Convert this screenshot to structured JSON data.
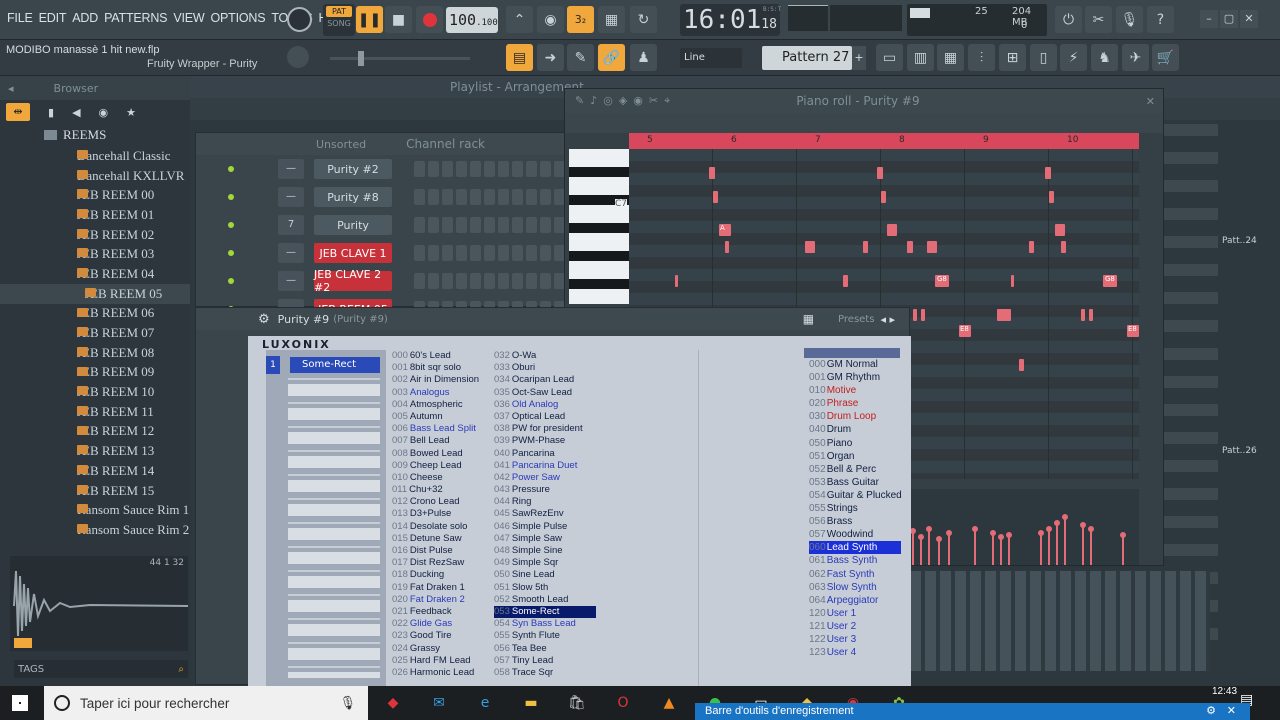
{
  "menu": [
    "FILE",
    "EDIT",
    "ADD",
    "PATTERNS",
    "VIEW",
    "OPTIONS",
    "TOOLS",
    "HELP"
  ],
  "transport": {
    "pat_label": "PAT",
    "song_label": "SONG",
    "tempo": "100",
    "tempo_fraction": ".100",
    "time_main": "16:01",
    "time_ticks": "18",
    "time_unit": "B:S:T"
  },
  "cpu": {
    "value": "25",
    "memory": "204 MB",
    "poly": "0"
  },
  "project": {
    "filename": "MODIBO manassè 1 hit new.flp",
    "hint": "Fruity Wrapper - Purity"
  },
  "toolbar": {
    "snap": "Line",
    "pattern": "Pattern 27"
  },
  "browser": {
    "title": "Browser",
    "root": "REEMS",
    "items": [
      "Dancehall Classic",
      "Dancehall KXLLVR",
      "JEB REEM 00",
      "JEB REEM 01",
      "JEB REEM 02",
      "JEB REEM 03",
      "JEB REEM 04",
      "JEB REEM 05",
      "JEB REEM 06",
      "JEB REEM 07",
      "JEB REEM 08",
      "JEB REEM 09",
      "JEB REEM 10",
      "JEB REEM 11",
      "JEB REEM 12",
      "JEB REEM 13",
      "JEB REEM 14",
      "JEB REEM 15",
      "Ransom Sauce Rim 1",
      "Ransom Sauce Rim 2"
    ],
    "selected_index": 7,
    "sample_info": "44 1 32",
    "tags_label": "TAGS"
  },
  "playlist": {
    "title": "Playlist - Arrangement",
    "pattern_labels": [
      "Patt..24",
      "Patt..26"
    ]
  },
  "channel_rack": {
    "title": "Channel rack",
    "filter": "Unsorted",
    "channels": [
      {
        "name": "Purity #2",
        "num": "—",
        "red": false
      },
      {
        "name": "Purity #8",
        "num": "—",
        "red": false
      },
      {
        "name": "Purity",
        "num": "7",
        "red": false
      },
      {
        "name": "JEB CLAVE 1",
        "num": "—",
        "red": true
      },
      {
        "name": "JEB CLAVE 2 #2",
        "num": "—",
        "red": true
      },
      {
        "name": "JEB REEM 05",
        "num": "",
        "red": true
      }
    ]
  },
  "piano_roll": {
    "title": "Piano roll - Purity #9",
    "ruler": [
      "5",
      "6",
      "7",
      "8",
      "9",
      "10"
    ],
    "key_label": "C7",
    "note_labels": [
      "A",
      "G8",
      "G8",
      "E8",
      "E8"
    ]
  },
  "purity": {
    "title": "Purity #9",
    "subtitle": "(Purity #9)",
    "presets_label": "Presets",
    "brand": "LUXONIX",
    "part1": "Some-Rect",
    "presets_a": [
      {
        "n": "000",
        "t": "60's Lead",
        "c": ""
      },
      {
        "n": "001",
        "t": "8bit sqr solo",
        "c": ""
      },
      {
        "n": "002",
        "t": "Air in Dimension",
        "c": ""
      },
      {
        "n": "003",
        "t": "Analogus",
        "c": "blue"
      },
      {
        "n": "004",
        "t": "Atmospheric",
        "c": ""
      },
      {
        "n": "005",
        "t": "Autumn",
        "c": ""
      },
      {
        "n": "006",
        "t": "Bass Lead Split",
        "c": "blue"
      },
      {
        "n": "007",
        "t": "Bell Lead",
        "c": ""
      },
      {
        "n": "008",
        "t": "Bowed Lead",
        "c": ""
      },
      {
        "n": "009",
        "t": "Cheep Lead",
        "c": ""
      },
      {
        "n": "010",
        "t": "Cheese",
        "c": ""
      },
      {
        "n": "011",
        "t": "Chu+32",
        "c": ""
      },
      {
        "n": "012",
        "t": "Crono Lead",
        "c": ""
      },
      {
        "n": "013",
        "t": "D3+Pulse",
        "c": ""
      },
      {
        "n": "014",
        "t": "Desolate solo",
        "c": ""
      },
      {
        "n": "015",
        "t": "Detune Saw",
        "c": ""
      },
      {
        "n": "016",
        "t": "Dist Pulse",
        "c": ""
      },
      {
        "n": "017",
        "t": "Dist RezSaw",
        "c": ""
      },
      {
        "n": "018",
        "t": "Ducking",
        "c": ""
      },
      {
        "n": "019",
        "t": "Fat Draken 1",
        "c": ""
      },
      {
        "n": "020",
        "t": "Fat Draken 2",
        "c": "blue"
      },
      {
        "n": "021",
        "t": "Feedback",
        "c": ""
      },
      {
        "n": "022",
        "t": "Glide Gas",
        "c": "blue"
      },
      {
        "n": "023",
        "t": "Good Tire",
        "c": ""
      },
      {
        "n": "024",
        "t": "Grassy",
        "c": ""
      },
      {
        "n": "025",
        "t": "Hard FM Lead",
        "c": ""
      },
      {
        "n": "026",
        "t": "Harmonic Lead",
        "c": ""
      }
    ],
    "presets_b": [
      {
        "n": "032",
        "t": "O-Wa",
        "c": ""
      },
      {
        "n": "033",
        "t": "Oburi",
        "c": ""
      },
      {
        "n": "034",
        "t": "Ocaripan Lead",
        "c": ""
      },
      {
        "n": "035",
        "t": "Oct-Saw Lead",
        "c": ""
      },
      {
        "n": "036",
        "t": "Old Analog",
        "c": "blue"
      },
      {
        "n": "037",
        "t": "Optical Lead",
        "c": ""
      },
      {
        "n": "038",
        "t": "PW for president",
        "c": ""
      },
      {
        "n": "039",
        "t": "PWM-Phase",
        "c": ""
      },
      {
        "n": "040",
        "t": "Pancarina",
        "c": ""
      },
      {
        "n": "041",
        "t": "Pancarina Duet",
        "c": "blue"
      },
      {
        "n": "042",
        "t": "Power Saw",
        "c": "blue"
      },
      {
        "n": "043",
        "t": "Pressure",
        "c": ""
      },
      {
        "n": "044",
        "t": "Ring",
        "c": ""
      },
      {
        "n": "045",
        "t": "SawRezEnv",
        "c": ""
      },
      {
        "n": "046",
        "t": "Simple Pulse",
        "c": ""
      },
      {
        "n": "047",
        "t": "Simple Saw",
        "c": ""
      },
      {
        "n": "048",
        "t": "Simple Sine",
        "c": ""
      },
      {
        "n": "049",
        "t": "Simple Sqr",
        "c": ""
      },
      {
        "n": "050",
        "t": "Sine Lead",
        "c": ""
      },
      {
        "n": "051",
        "t": "Slow 5th",
        "c": ""
      },
      {
        "n": "052",
        "t": "Smooth Lead",
        "c": ""
      },
      {
        "n": "053",
        "t": "Some-Rect",
        "c": "hl"
      },
      {
        "n": "054",
        "t": "Syn Bass Lead",
        "c": "blue"
      },
      {
        "n": "055",
        "t": "Synth Flute",
        "c": ""
      },
      {
        "n": "056",
        "t": "Tea Bee",
        "c": ""
      },
      {
        "n": "057",
        "t": "Tiny Lead",
        "c": ""
      },
      {
        "n": "058",
        "t": "Trace Sqr",
        "c": ""
      }
    ],
    "categories": [
      {
        "n": "000",
        "t": "GM Normal",
        "c": ""
      },
      {
        "n": "001",
        "t": "GM Rhythm",
        "c": ""
      },
      {
        "n": "010",
        "t": "Motive",
        "c": "red"
      },
      {
        "n": "020",
        "t": "Phrase",
        "c": "red"
      },
      {
        "n": "030",
        "t": "Drum Loop",
        "c": "red"
      },
      {
        "n": "040",
        "t": "Drum",
        "c": ""
      },
      {
        "n": "050",
        "t": "Piano",
        "c": ""
      },
      {
        "n": "051",
        "t": "Organ",
        "c": ""
      },
      {
        "n": "052",
        "t": "Bell & Perc",
        "c": ""
      },
      {
        "n": "053",
        "t": "Bass Guitar",
        "c": ""
      },
      {
        "n": "054",
        "t": "Guitar & Plucked",
        "c": ""
      },
      {
        "n": "055",
        "t": "Strings",
        "c": ""
      },
      {
        "n": "056",
        "t": "Brass",
        "c": ""
      },
      {
        "n": "057",
        "t": "Woodwind",
        "c": ""
      },
      {
        "n": "060",
        "t": "Lead Synth",
        "c": "hl"
      },
      {
        "n": "061",
        "t": "Bass Synth",
        "c": "blue"
      },
      {
        "n": "062",
        "t": "Fast Synth",
        "c": "blue"
      },
      {
        "n": "063",
        "t": "Slow Synth",
        "c": "blue"
      },
      {
        "n": "064",
        "t": "Arpeggiator",
        "c": "blue"
      },
      {
        "n": "120",
        "t": "User 1",
        "c": "blue"
      },
      {
        "n": "121",
        "t": "User 2",
        "c": "blue"
      },
      {
        "n": "122",
        "t": "User 3",
        "c": "blue"
      },
      {
        "n": "123",
        "t": "User 4",
        "c": "blue"
      }
    ]
  },
  "taskbar": {
    "search_placeholder": "Taper ici pour rechercher",
    "clock": "12:43",
    "recording_bar": "Barre d'outils d'enregistrement"
  },
  "colors": {
    "accent": "#f0a73c",
    "note": "#e46c77",
    "red_channel": "#c7323a",
    "taskbar": "#1c1f22"
  }
}
